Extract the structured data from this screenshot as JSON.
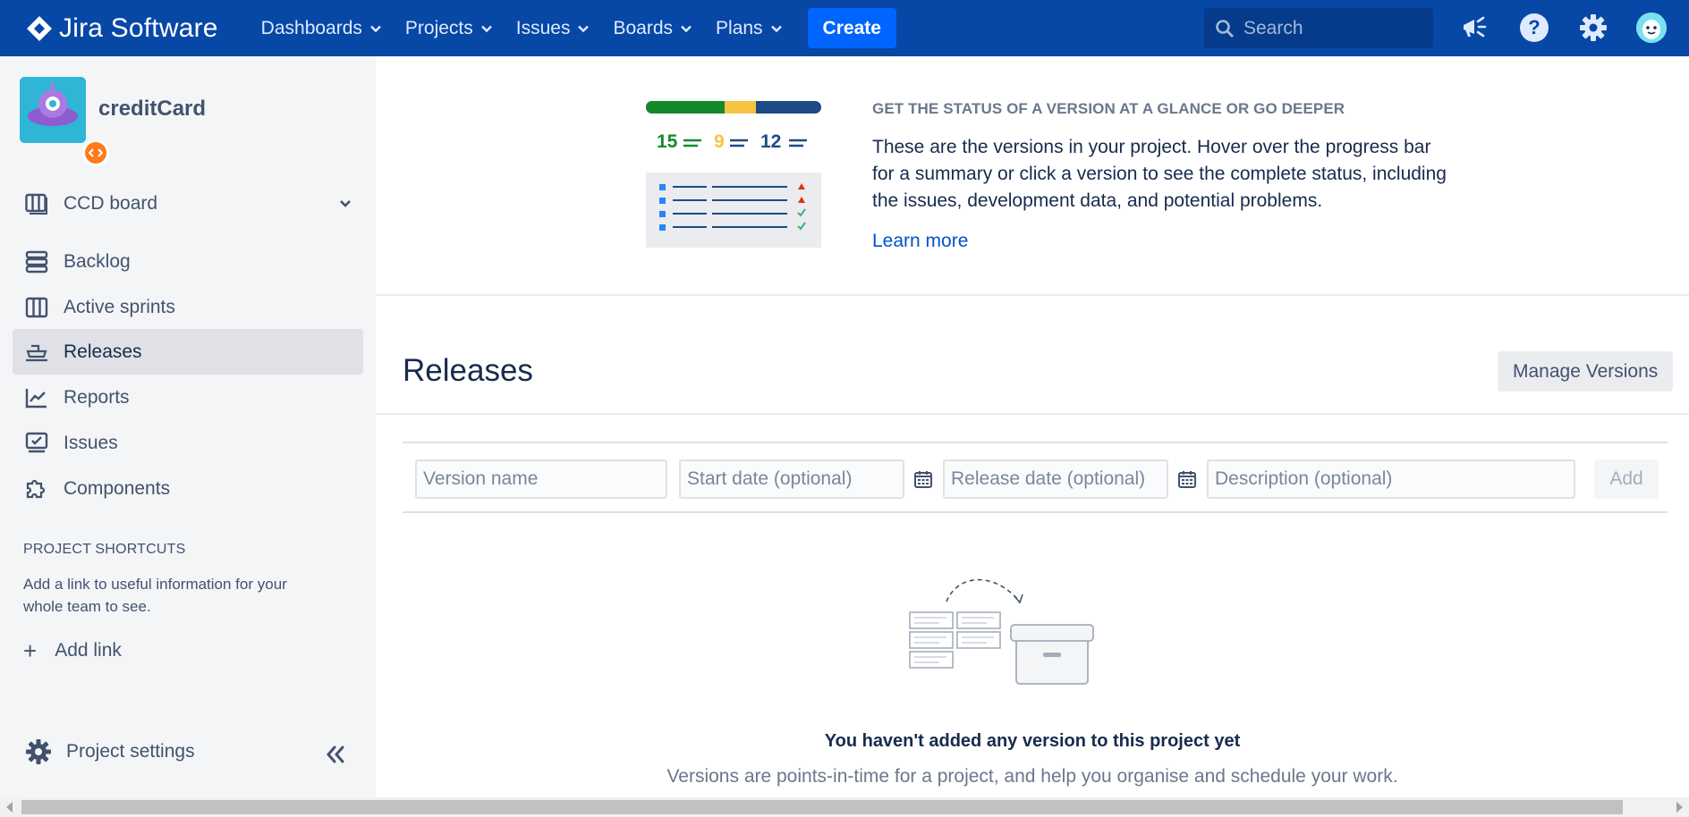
{
  "topnav": {
    "product_name": "Jira Software",
    "menu": [
      {
        "label": "Dashboards"
      },
      {
        "label": "Projects"
      },
      {
        "label": "Issues"
      },
      {
        "label": "Boards"
      },
      {
        "label": "Plans"
      }
    ],
    "create_label": "Create",
    "search_placeholder": "Search",
    "brand_color": "#0747A6"
  },
  "sidebar": {
    "project_name": "creditCard",
    "board_label": "CCD board",
    "items": [
      {
        "label": "Backlog",
        "icon": "backlog-icon"
      },
      {
        "label": "Active sprints",
        "icon": "board-icon"
      },
      {
        "label": "Releases",
        "icon": "ship-icon",
        "active": true
      },
      {
        "label": "Reports",
        "icon": "chart-icon"
      },
      {
        "label": "Issues",
        "icon": "issues-icon"
      },
      {
        "label": "Components",
        "icon": "puzzle-icon"
      }
    ],
    "shortcuts_title": "PROJECT SHORTCUTS",
    "shortcuts_desc": "Add a link to useful information for your whole team to see.",
    "add_link_label": "Add link",
    "settings_label": "Project settings"
  },
  "intro": {
    "counts": {
      "done": "15",
      "in_progress": "9",
      "todo": "12"
    },
    "title": "GET THE STATUS OF A VERSION AT A GLANCE OR GO DEEPER",
    "text": "These are the versions in your project. Hover over the progress bar for a summary or click a version to see the complete status, including the issues, development data, and potential problems.",
    "learn_more": "Learn more"
  },
  "releases": {
    "title": "Releases",
    "manage_label": "Manage Versions",
    "form": {
      "version_placeholder": "Version name",
      "start_placeholder": "Start date (optional)",
      "release_placeholder": "Release date (optional)",
      "description_placeholder": "Description (optional)",
      "add_label": "Add"
    },
    "empty_title": "You haven't added any version to this project yet",
    "empty_desc": "Versions are points-in-time for a project, and help you organise and schedule your work."
  }
}
